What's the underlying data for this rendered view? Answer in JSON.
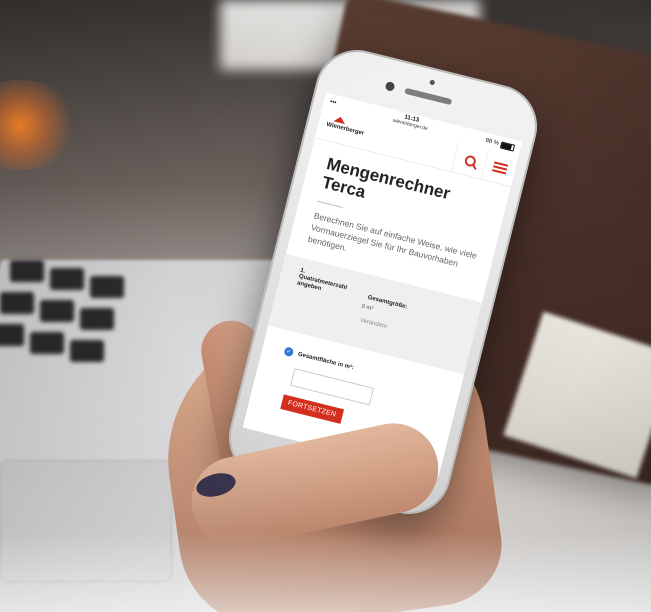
{
  "status": {
    "time": "11:13",
    "url": "wienerberger.de",
    "battery": "88 %"
  },
  "site": {
    "logo": "Wienerberger"
  },
  "page": {
    "title_line1": "Mengenrechner",
    "title_line2": "Terca",
    "intro": "Berechnen Sie auf einfache Weise, wie viele Vormauerziegel Sie für Ihr Bauvorhaben benötigen."
  },
  "step": {
    "number": "1.",
    "label": "Quatratmeterzahl angeben",
    "total_label": "Gesamtgröße:",
    "unit": "0 m²",
    "change": "Verändern"
  },
  "form": {
    "field_label": "Gesamtfläche in m²:",
    "submit_label": "FORTSETZEN"
  },
  "colors": {
    "brand_red": "#d42e1f",
    "check_blue": "#2e79d6"
  }
}
